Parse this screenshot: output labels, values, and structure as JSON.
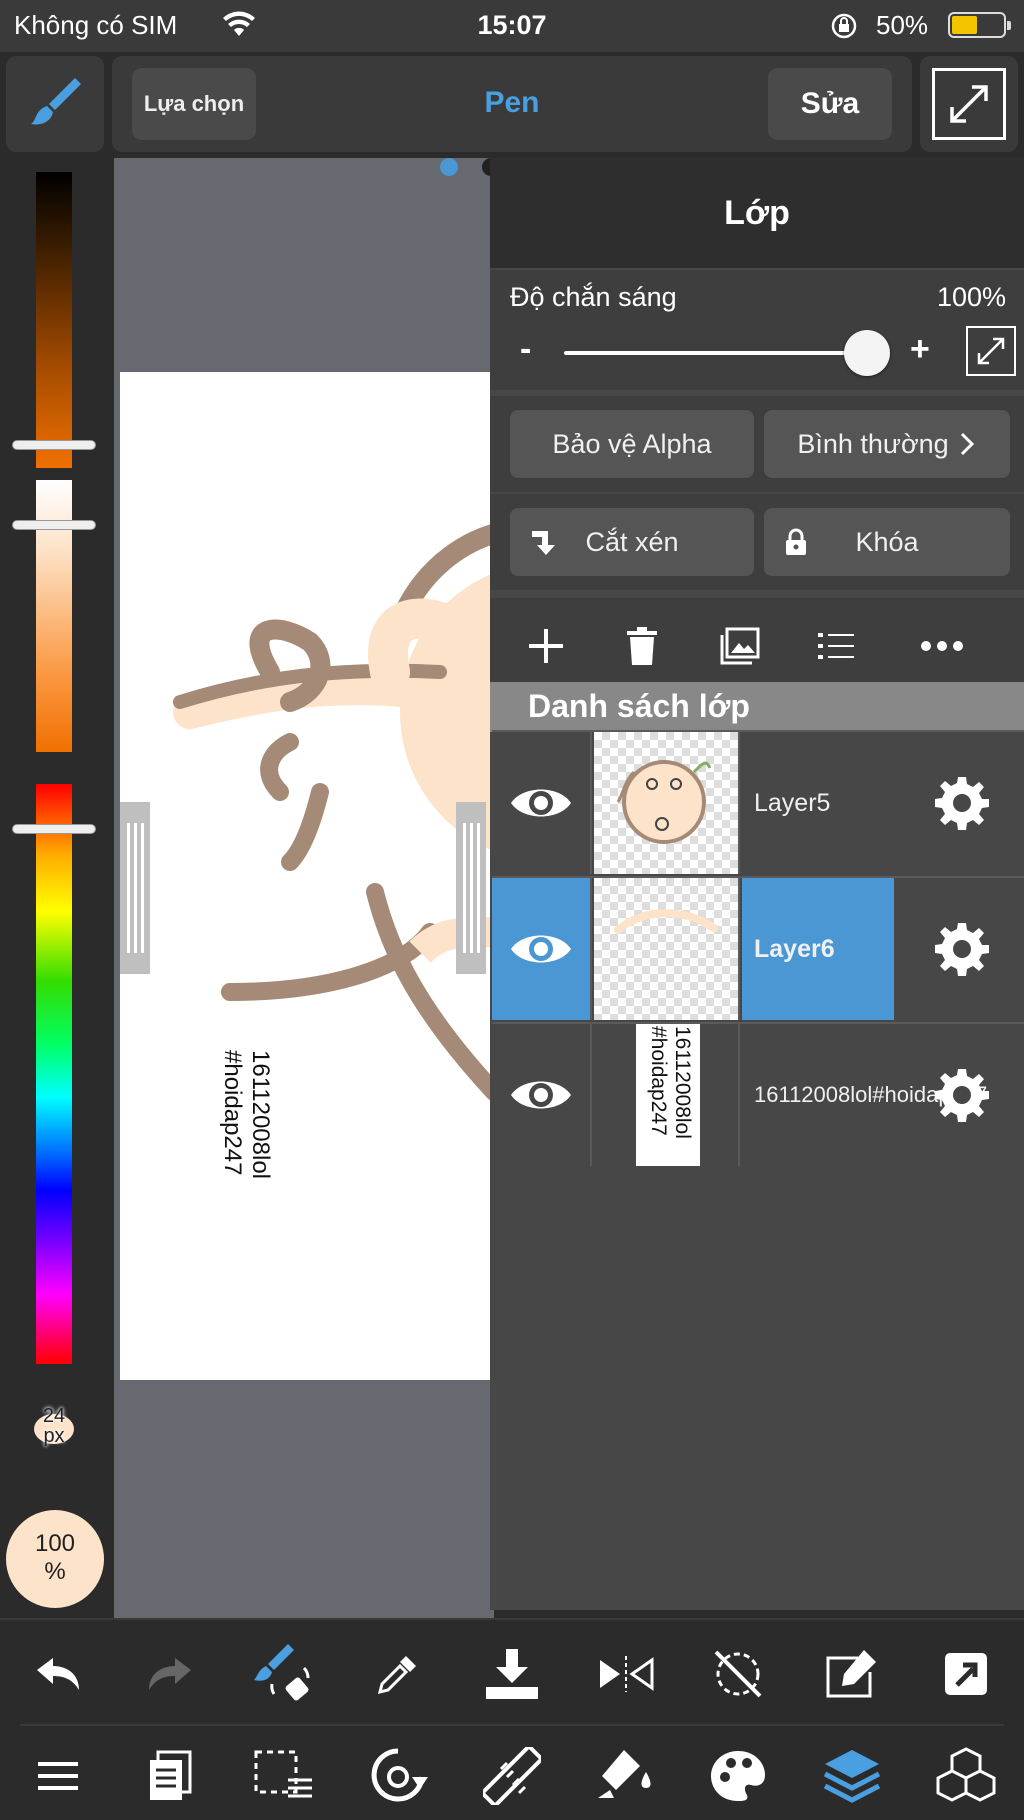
{
  "status_bar": {
    "carrier": "Không có SIM",
    "time": "15:07",
    "battery_percent": "50%",
    "battery_level": 0.5,
    "icons": [
      "wifi-icon",
      "rotation-lock-icon",
      "battery-icon"
    ]
  },
  "top_bar": {
    "select_label": "Lựa chọn",
    "tool_title": "Pen",
    "edit_label": "Sửa",
    "icons": [
      "brush-icon",
      "fullscreen-icon"
    ]
  },
  "color_panel": {
    "brush_size": "24",
    "brush_size_unit": "px",
    "opacity": "100",
    "opacity_unit": "%",
    "current_color": "#fde3c9"
  },
  "canvas": {
    "text_line1": "16112008lol",
    "text_line2": "#hoidap247",
    "stroke_brown": "#a58b77",
    "stroke_peach": "#fde3c9"
  },
  "layer_panel": {
    "title": "Lớp",
    "opacity_label": "Độ chắn sáng",
    "opacity_value": "100%",
    "opacity_level": 1.0,
    "minus": "-",
    "plus": "+",
    "alpha_protect_label": "Bảo vệ Alpha",
    "blend_mode_label": "Bình thường",
    "clipping_label": "Cắt xén",
    "lock_label": "Khóa",
    "actions": [
      "add-icon",
      "trash-icon",
      "image-icon",
      "list-icon",
      "more-icon"
    ],
    "list_title": "Danh sách lớp",
    "layers": [
      {
        "name": "Layer5",
        "visible": true,
        "selected": false
      },
      {
        "name": "Layer6",
        "visible": true,
        "selected": true
      },
      {
        "name_line1": "16112008lol",
        "name_line2": "#hoidap247",
        "visible": true,
        "selected": false
      }
    ]
  },
  "bottom_toolbar": {
    "row1": [
      "undo-icon",
      "redo-icon",
      "brush-swap-icon",
      "eyedropper-icon",
      "download-icon",
      "flip-icon",
      "rotate-off-icon",
      "edit-icon",
      "share-icon"
    ],
    "row2": [
      "menu-icon",
      "pages-icon",
      "selection-icon",
      "transform-icon",
      "ruler-icon",
      "fill-icon",
      "palette-icon",
      "layers-icon",
      "materials-icon"
    ],
    "accent": "#4a9fe0"
  }
}
